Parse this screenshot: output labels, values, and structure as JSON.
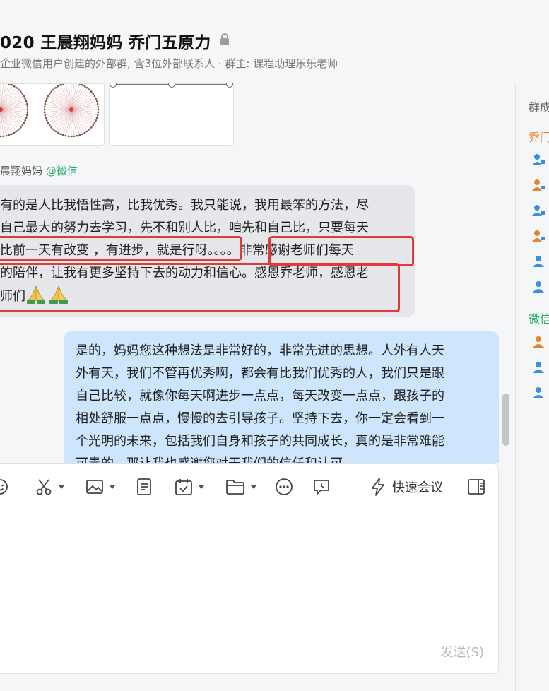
{
  "header": {
    "title": "020 王晨翔妈妈 乔门五原力",
    "subtitle": "企业微信用户创建的外部群, 含3位外部联系人 · 群主: 课程助理乐乐老师",
    "icon": "lock-icon"
  },
  "messages": {
    "incoming": {
      "sender_name": "晨翔妈妈",
      "sender_source": "@微信",
      "lines": [
        "有的是人比我悟性高，比我优秀。我只能说，我用最笨的方法，尽",
        "自己最大的努力去学习，先不和别人比，咱先和自己比，只要每天",
        "比前一天有改变 ，有进步，就是行呀。。。。非常感谢老师们每天",
        "的陪伴，让我有更多坚持下去的动力和信心。感恩乔老师，感恩老",
        "师们"
      ],
      "emoji": "folded-hands-icon"
    },
    "outgoing": {
      "lines": [
        "是的，妈妈您这种想法是非常好的，非常先进的思想。人外有人天",
        "外有天，我们不管再优秀啊，都会有比我们优秀的人，我们只是跟",
        "自己比较，就像你每天啊进步一点点，每天改变一点点，跟孩子的",
        "相处舒服一点点，慢慢的去引导孩子。坚持下去，你一定会看到一",
        "个光明的未来，包括我们自身和孩子的共同成长，真的是非常难能",
        "可贵的，那让我也感谢您对于我们的信任和认可"
      ]
    }
  },
  "members": {
    "header": "群成",
    "groups": [
      {
        "label": "乔门",
        "color": "#e8832a"
      },
      {
        "label": "微信",
        "color": "#2aae67"
      }
    ]
  },
  "toolbar": {
    "icons": [
      "emoji-icon",
      "scissors-icon",
      "image-icon",
      "document-icon",
      "calendar-check-icon",
      "folder-icon",
      "more-icon",
      "chat-bubble-icon",
      "lightning-icon",
      "sidebar-toggle-icon"
    ],
    "meeting_label": "快速会议"
  },
  "composer": {
    "send_label": "发送(S)"
  },
  "colors": {
    "highlight": "#e23a3a",
    "incoming_bubble": "#e6e7ea",
    "outgoing_bubble": "#cde6fd",
    "wechat_green": "#2aae67",
    "group_orange": "#e8832a",
    "member_blue": "#3a8ee6"
  }
}
